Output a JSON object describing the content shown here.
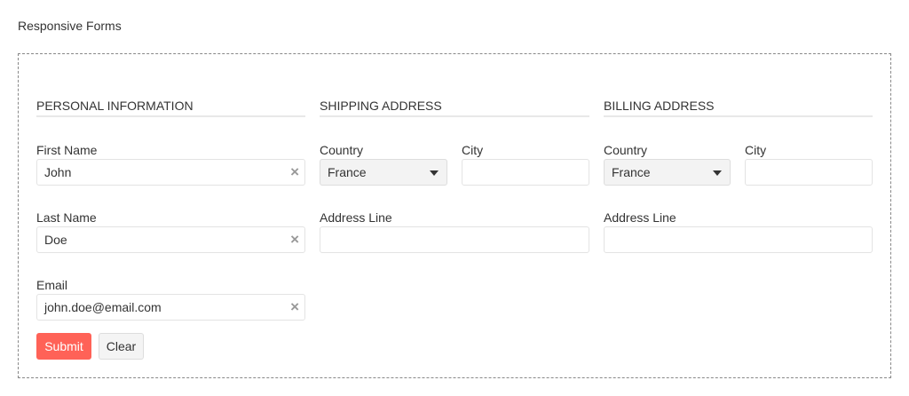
{
  "title": "Responsive Forms",
  "sections": {
    "personal": "PERSONAL INFORMATION",
    "shipping": "SHIPPING ADDRESS",
    "billing": "BILLING ADDRESS"
  },
  "personal": {
    "first_name": {
      "label": "First Name",
      "value": "John"
    },
    "last_name": {
      "label": "Last Name",
      "value": "Doe"
    },
    "email": {
      "label": "Email",
      "value": "john.doe@email.com"
    }
  },
  "shipping": {
    "country_label": "Country",
    "country": "France",
    "city_label": "City",
    "city": "",
    "address_label": "Address Line",
    "address": ""
  },
  "billing": {
    "country_label": "Country",
    "country": "France",
    "city_label": "City",
    "city": "",
    "address_label": "Address Line",
    "address": ""
  },
  "buttons": {
    "submit": "Submit",
    "clear": "Clear"
  },
  "icons": {
    "clear": "×"
  },
  "colors": {
    "submit": "#ff6257"
  }
}
